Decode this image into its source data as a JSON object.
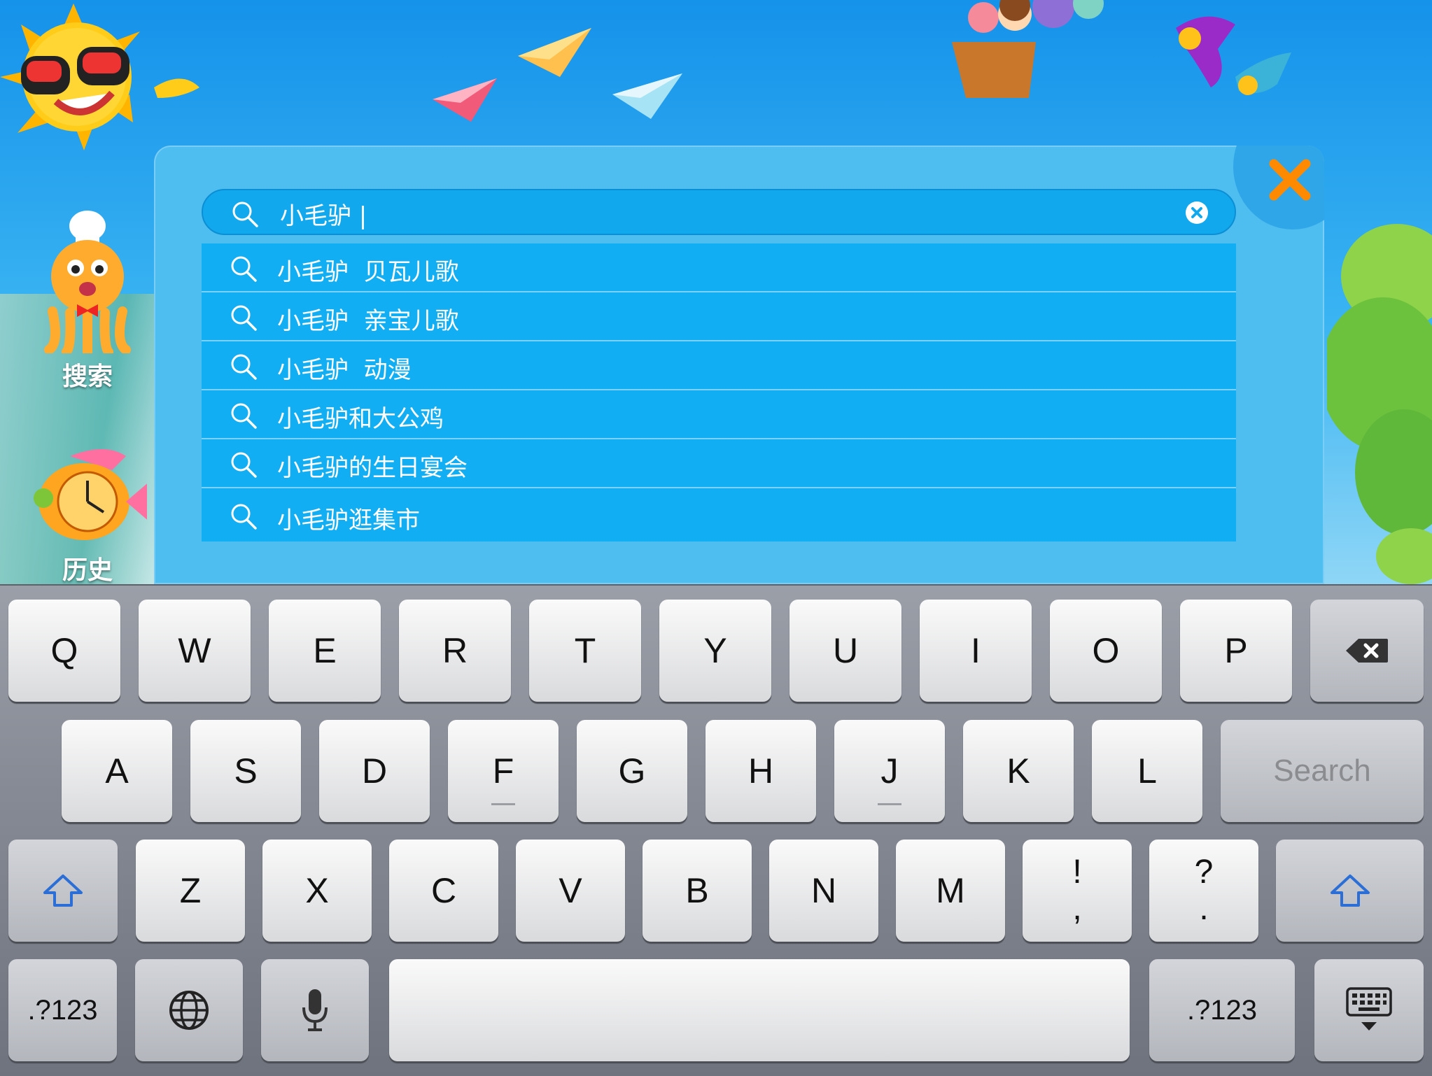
{
  "side_nav": [
    {
      "label": "搜索",
      "icon": "octopus-chef-icon"
    },
    {
      "label": "历史",
      "icon": "fish-clock-icon"
    }
  ],
  "search": {
    "value": "小毛驴 |",
    "suggestions": [
      "小毛驴  贝瓦儿歌",
      "小毛驴  亲宝儿歌",
      "小毛驴  动漫",
      "小毛驴和大公鸡",
      "小毛驴的生日宴会",
      "小毛驴逛集市"
    ]
  },
  "keyboard": {
    "row1": [
      "Q",
      "W",
      "E",
      "R",
      "T",
      "Y",
      "U",
      "I",
      "O",
      "P"
    ],
    "row2": [
      "A",
      "S",
      "D",
      "F",
      "G",
      "H",
      "J",
      "K",
      "L"
    ],
    "row3": [
      "Z",
      "X",
      "C",
      "V",
      "B",
      "N",
      "M"
    ],
    "punct1": {
      "top": "!",
      "bottom": ","
    },
    "punct2": {
      "top": "?",
      "bottom": "."
    },
    "search_label": "Search",
    "numbers_label_left": ".?123",
    "numbers_label_right": ".?123"
  },
  "colors": {
    "accent_orange": "#ff8a00",
    "panel_blue": "#4ebdf0",
    "suggestion_blue": "#12aef3"
  }
}
